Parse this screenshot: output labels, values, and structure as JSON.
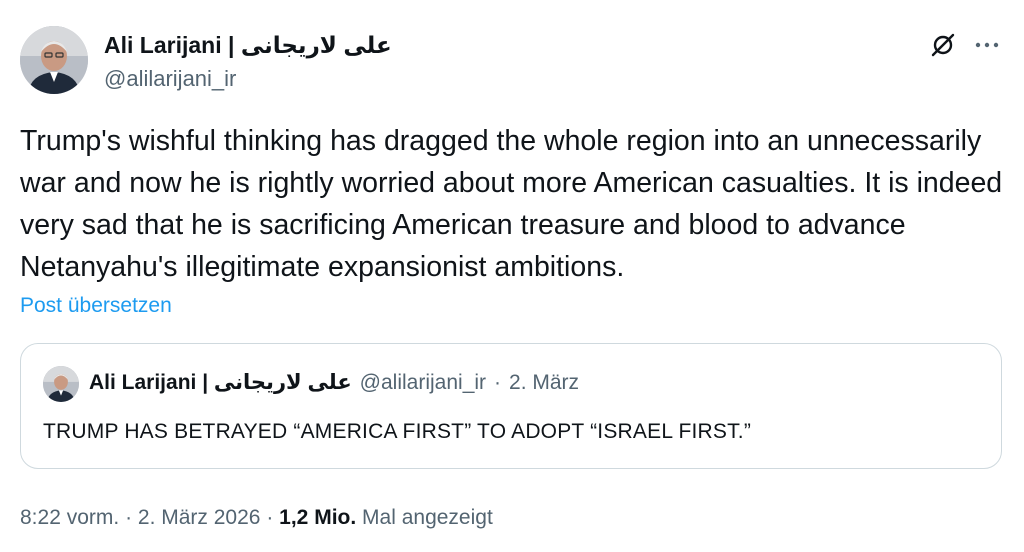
{
  "author": {
    "name": "Ali Larijani | علی لاریجانی",
    "handle": "@alilarijani_ir"
  },
  "icons": {
    "grok": "grok-icon",
    "more": "more-icon"
  },
  "tweet": {
    "text": "Trump's wishful thinking has dragged the whole region into an unnecessarily war and now he is rightly worried about more American casualties. It is indeed very sad that he is sacrificing American treasure and blood to advance Netanyahu's illegitimate expansionist ambitions.",
    "translate_label": "Post übersetzen"
  },
  "quote": {
    "name": "Ali Larijani | علی لاریجانی",
    "handle": "@alilarijani_ir",
    "separator": "·",
    "date": "2. März",
    "text": "TRUMP HAS BETRAYED “AMERICA FIRST” TO ADOPT “ISRAEL FIRST.”"
  },
  "footer": {
    "time": "8:22 vorm.",
    "sep1": "·",
    "date": "2. März 2026",
    "sep2": "·",
    "views_count": "1,2 Mio.",
    "views_label": "Mal angezeigt"
  }
}
